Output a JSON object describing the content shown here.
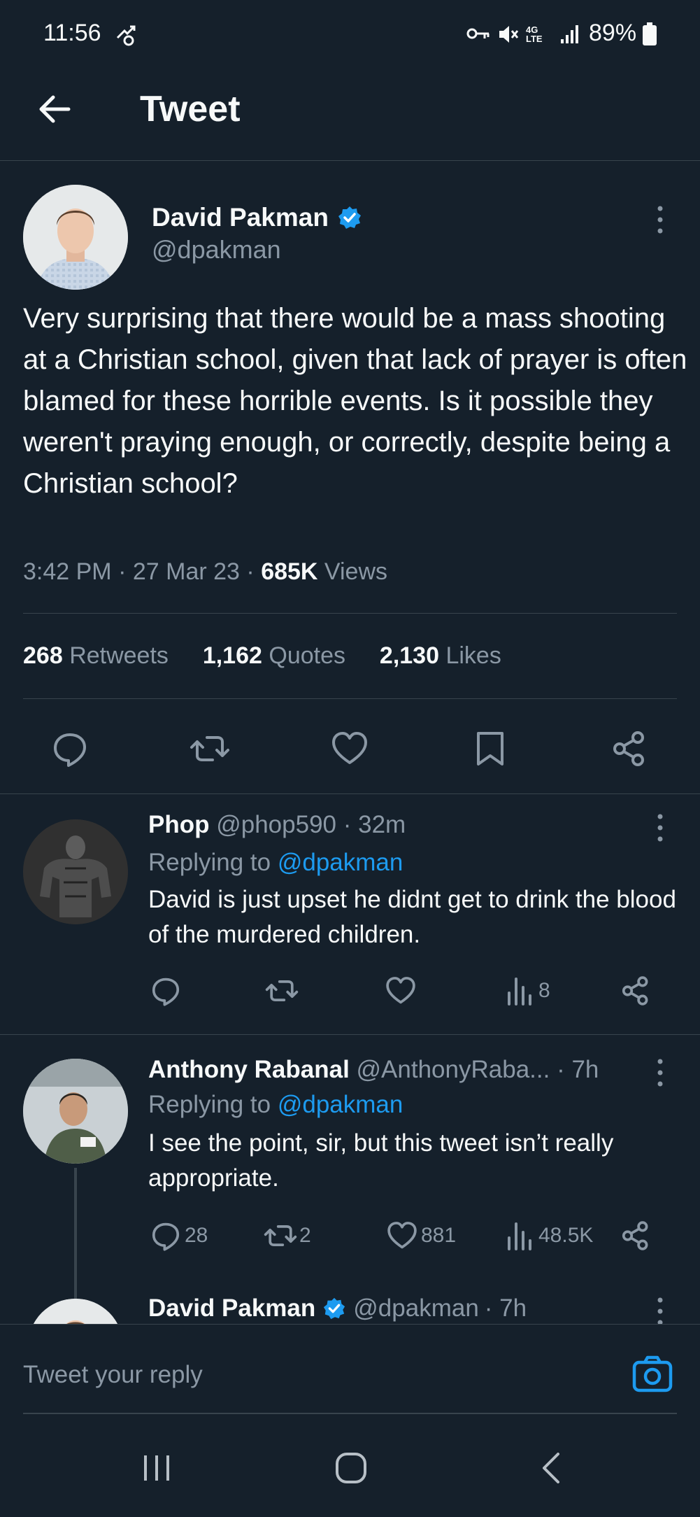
{
  "status_bar": {
    "time": "11:56",
    "battery": "89%",
    "network": "4G LTE"
  },
  "header": {
    "title": "Tweet"
  },
  "main_tweet": {
    "author_name": "David Pakman",
    "handle": "@dpakman",
    "text": "Very surprising that there would be a mass shooting at a Christian school, given that lack of prayer is often blamed for these horrible events. Is it possible they weren't praying enough, or correctly, despite being a Christian school?",
    "time": "3:42 PM",
    "date": "27 Mar 23",
    "views_count": "685K",
    "views_label": "Views",
    "retweets_count": "268",
    "retweets_label": "Retweets",
    "quotes_count": "1,162",
    "quotes_label": "Quotes",
    "likes_count": "2,130",
    "likes_label": "Likes"
  },
  "replies": [
    {
      "author_name": "Phop",
      "handle": "@phop590",
      "time": "· 32m",
      "replying_prefix": "Replying to",
      "replying_to": "@dpakman",
      "text": "David is just upset he didnt get to drink the blood of the murdered children.",
      "reply_count": "",
      "retweet_count": "",
      "like_count": "",
      "view_count": "8"
    },
    {
      "author_name": "Anthony Rabanal",
      "handle": "@AnthonyRaba...",
      "time": "· 7h",
      "replying_prefix": "Replying to",
      "replying_to": "@dpakman",
      "text": "I see the point, sir, but this tweet isn’t really appropriate.",
      "reply_count": "28",
      "retweet_count": "2",
      "like_count": "881",
      "view_count": "48.5K"
    },
    {
      "author_name": "David Pakman",
      "handle": "@dpakman",
      "time": "· 7h"
    }
  ],
  "composer": {
    "placeholder": "Tweet your reply"
  },
  "colors": {
    "background": "#15202b",
    "accent": "#1d9bf0",
    "muted": "#8b98a5",
    "divider": "#38444d"
  }
}
